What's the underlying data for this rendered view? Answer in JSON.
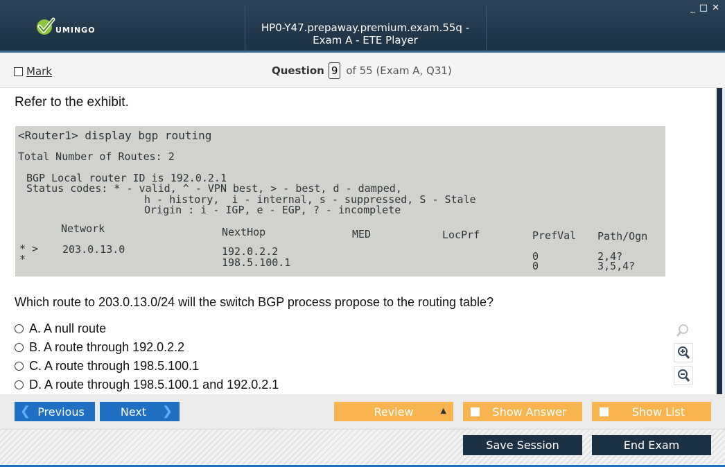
{
  "window": {
    "title": "HP0-Y47.prepaway.premium.exam.55q - Exam A - ETE Player",
    "logo_text": "UMINGO",
    "controls": [
      "_",
      "□",
      "✕"
    ]
  },
  "header": {
    "mark_label": "Mark",
    "question_label": "Question",
    "question_number": "9",
    "question_of": "of 55 (Exam A, Q31)"
  },
  "content": {
    "refer_text": "Refer to the exhibit.",
    "exhibit": {
      "command": "<Router1> display bgp routing",
      "total": "Total Number of Routes: 2",
      "router_id": "BGP Local router ID is 192.0.2.1",
      "status_line1": "Status codes: * - valid, ^ - VPN best, > - best, d - damped,",
      "status_line2": "h - history,  i - internal, s - suppressed, S - Stale",
      "status_line3": "Origin : i - IGP, e - EGP, ? - incomplete",
      "col_network": "Network",
      "col_nexthop": "NextHop",
      "col_med": "MED",
      "col_locprf": "LocPrf",
      "col_prefval": "PrefVal",
      "col_path": "Path/Ogn",
      "row1_flags": "* >",
      "row1_network": "203.0.13.0",
      "row1_nexthop": "192.0.2.2",
      "row1_prefval": "0",
      "row1_path": "2,4?",
      "row2_flags": "*",
      "row2_nexthop": "198.5.100.1",
      "row2_prefval": "0",
      "row2_path": "3,5,4?"
    },
    "question_text": "Which route to 203.0.13.0/24 will the switch BGP process propose to the routing table?",
    "answers": [
      {
        "letter": "A.",
        "text": "A null route"
      },
      {
        "letter": "B.",
        "text": "A route through 192.0.2.2"
      },
      {
        "letter": "C.",
        "text": "A route through 198.5.100.1"
      },
      {
        "letter": "D.",
        "text": "A route through 198.5.100.1 and 192.0.2.1"
      }
    ]
  },
  "navbar": {
    "previous_label": "Previous",
    "next_label": "Next",
    "review_label": "Review",
    "show_answer_label": "Show Answer",
    "show_list_label": "Show List"
  },
  "footer": {
    "save_label": "Save Session",
    "end_label": "End Exam"
  },
  "colors": {
    "titlebar": "#1d3144",
    "primary_button": "#1f6fc4",
    "orange_button": "#f7b44f",
    "dark_button": "#1d3144"
  }
}
